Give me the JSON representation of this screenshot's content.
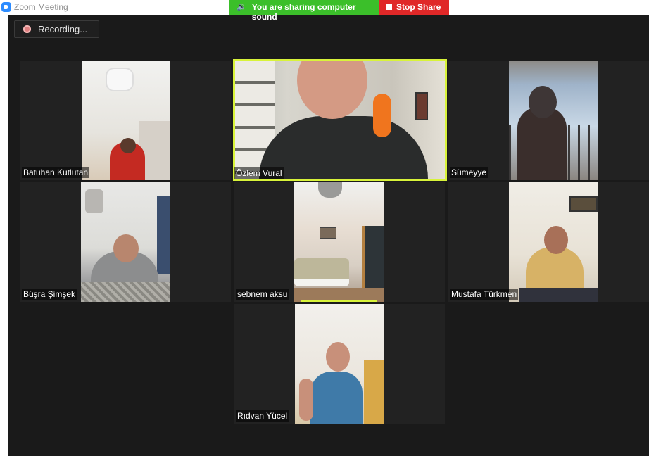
{
  "window": {
    "title": "Zoom Meeting"
  },
  "share_banner": {
    "status": "You are sharing computer sound",
    "stop_label": "Stop Share",
    "colors": {
      "status_bg": "#3bbf2a",
      "stop_bg": "#e02828"
    }
  },
  "recording": {
    "label": "Recording..."
  },
  "active_speaker_color": "#d8f33a",
  "participants": [
    {
      "name": "Batuhan Kutlutan"
    },
    {
      "name": "Özlem Vural"
    },
    {
      "name": "Sümeyye"
    },
    {
      "name": "Büşra Şimşek"
    },
    {
      "name": "sebnem aksu"
    },
    {
      "name": "Mustafa Türkmen"
    },
    {
      "name": "Rıdvan Yücel"
    }
  ]
}
